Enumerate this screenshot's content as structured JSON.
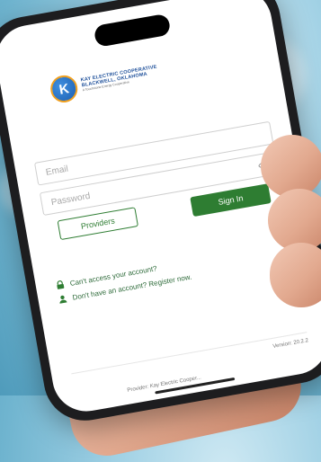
{
  "branding": {
    "logo_letter": "K",
    "line1": "KAY ELECTRIC COOPERATIVE",
    "line2": "BLACKWELL, OKLAHOMA",
    "tagline": "A Touchstone Energy Cooperative",
    "color": "#1d4f9a"
  },
  "login": {
    "email_placeholder": "Email",
    "password_placeholder": "Password",
    "providers_label": "Providers",
    "signin_label": "Sign In",
    "accent_color": "#2e7d32"
  },
  "links": {
    "cant_access": "Can't access your account?",
    "register": "Don't have an account? Register now.",
    "cant_access_icon": "lock-icon",
    "register_icon": "person-icon"
  },
  "footer": {
    "version": "Version: 20.2.2",
    "provider": "Provider: Kay Electric Cooper..."
  }
}
